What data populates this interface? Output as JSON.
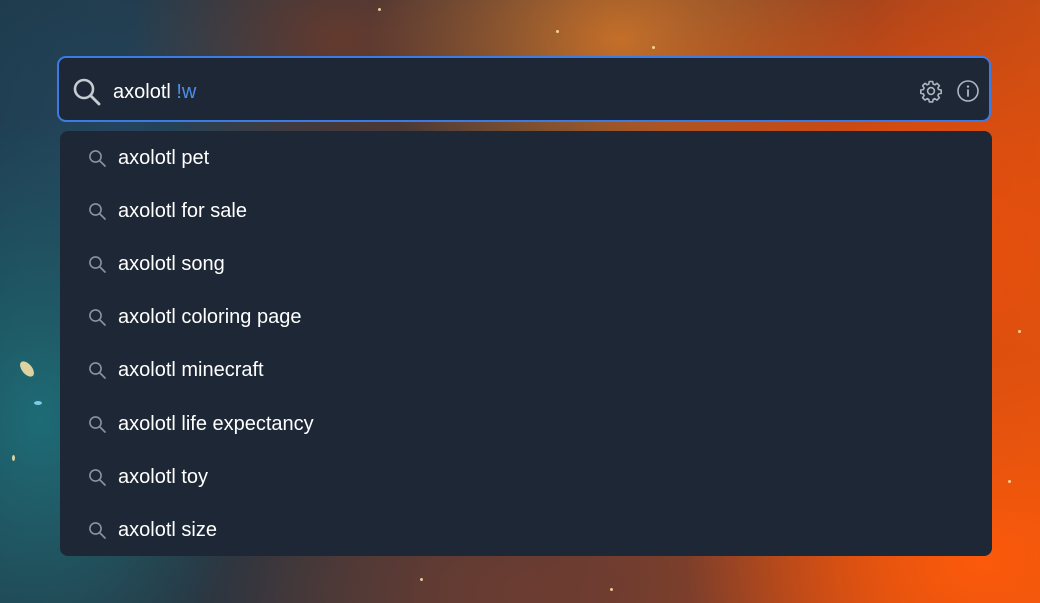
{
  "search": {
    "query_text": "axolotl ",
    "query_bang": "!w",
    "icons": {
      "search": "search-icon",
      "settings": "gear-icon",
      "info": "info-icon"
    }
  },
  "suggestions": [
    {
      "label": "axolotl pet"
    },
    {
      "label": "axolotl for sale"
    },
    {
      "label": "axolotl song"
    },
    {
      "label": "axolotl coloring page"
    },
    {
      "label": "axolotl minecraft"
    },
    {
      "label": "axolotl life expectancy"
    },
    {
      "label": "axolotl toy"
    },
    {
      "label": "axolotl size"
    }
  ],
  "colors": {
    "accent": "#3d7be4",
    "bang": "#4d8fe8",
    "panel": "#1e2736"
  }
}
